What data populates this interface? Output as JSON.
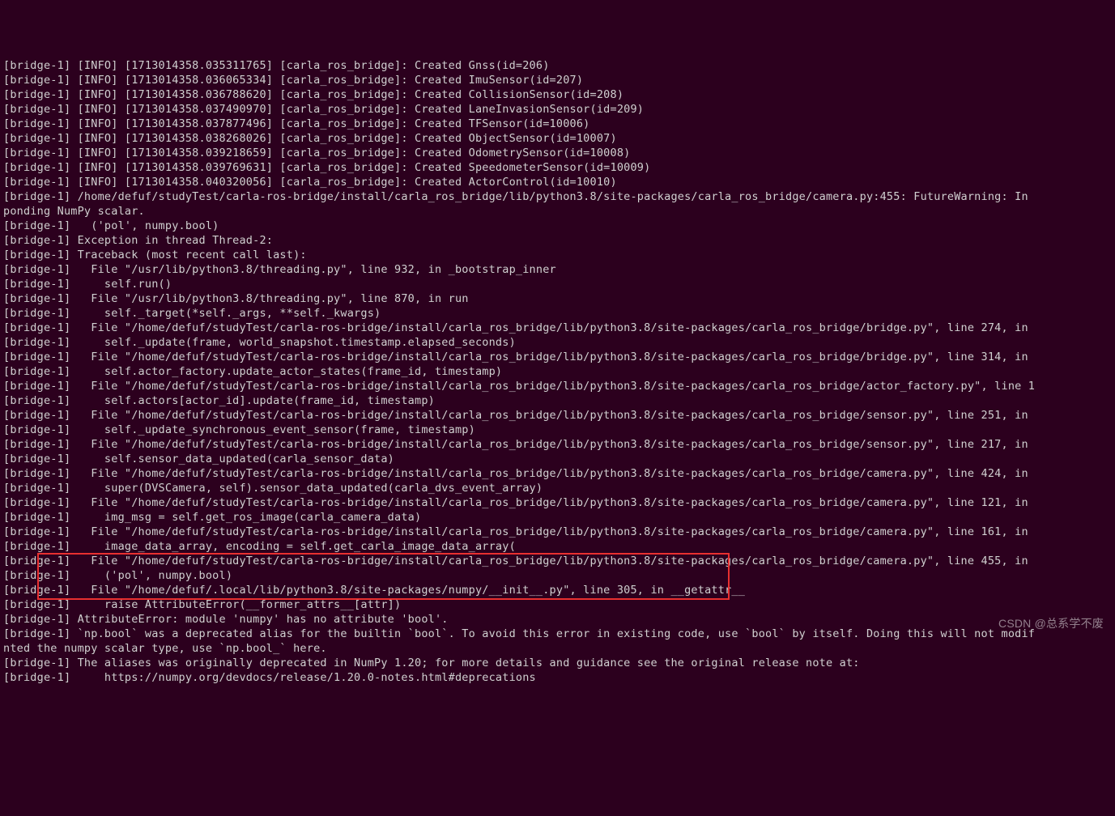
{
  "watermark": "CSDN @总系学不废",
  "lines": [
    "[bridge-1] [INFO] [1713014358.035311765] [carla_ros_bridge]: Created Gnss(id=206)",
    "[bridge-1] [INFO] [1713014358.036065334] [carla_ros_bridge]: Created ImuSensor(id=207)",
    "[bridge-1] [INFO] [1713014358.036788620] [carla_ros_bridge]: Created CollisionSensor(id=208)",
    "[bridge-1] [INFO] [1713014358.037490970] [carla_ros_bridge]: Created LaneInvasionSensor(id=209)",
    "[bridge-1] [INFO] [1713014358.037877496] [carla_ros_bridge]: Created TFSensor(id=10006)",
    "[bridge-1] [INFO] [1713014358.038268026] [carla_ros_bridge]: Created ObjectSensor(id=10007)",
    "[bridge-1] [INFO] [1713014358.039218659] [carla_ros_bridge]: Created OdometrySensor(id=10008)",
    "[bridge-1] [INFO] [1713014358.039769631] [carla_ros_bridge]: Created SpeedometerSensor(id=10009)",
    "[bridge-1] [INFO] [1713014358.040320056] [carla_ros_bridge]: Created ActorControl(id=10010)",
    "[bridge-1] /home/defuf/studyTest/carla-ros-bridge/install/carla_ros_bridge/lib/python3.8/site-packages/carla_ros_bridge/camera.py:455: FutureWarning: In ",
    "ponding NumPy scalar.",
    "[bridge-1]   ('pol', numpy.bool)",
    "[bridge-1] Exception in thread Thread-2:",
    "[bridge-1] Traceback (most recent call last):",
    "[bridge-1]   File \"/usr/lib/python3.8/threading.py\", line 932, in _bootstrap_inner",
    "[bridge-1]     self.run()",
    "[bridge-1]   File \"/usr/lib/python3.8/threading.py\", line 870, in run",
    "[bridge-1]     self._target(*self._args, **self._kwargs)",
    "[bridge-1]   File \"/home/defuf/studyTest/carla-ros-bridge/install/carla_ros_bridge/lib/python3.8/site-packages/carla_ros_bridge/bridge.py\", line 274, in ",
    "[bridge-1]     self._update(frame, world_snapshot.timestamp.elapsed_seconds)",
    "[bridge-1]   File \"/home/defuf/studyTest/carla-ros-bridge/install/carla_ros_bridge/lib/python3.8/site-packages/carla_ros_bridge/bridge.py\", line 314, in ",
    "[bridge-1]     self.actor_factory.update_actor_states(frame_id, timestamp)",
    "[bridge-1]   File \"/home/defuf/studyTest/carla-ros-bridge/install/carla_ros_bridge/lib/python3.8/site-packages/carla_ros_bridge/actor_factory.py\", line 1",
    "[bridge-1]     self.actors[actor_id].update(frame_id, timestamp)",
    "[bridge-1]   File \"/home/defuf/studyTest/carla-ros-bridge/install/carla_ros_bridge/lib/python3.8/site-packages/carla_ros_bridge/sensor.py\", line 251, in ",
    "[bridge-1]     self._update_synchronous_event_sensor(frame, timestamp)",
    "[bridge-1]   File \"/home/defuf/studyTest/carla-ros-bridge/install/carla_ros_bridge/lib/python3.8/site-packages/carla_ros_bridge/sensor.py\", line 217, in ",
    "[bridge-1]     self.sensor_data_updated(carla_sensor_data)",
    "[bridge-1]   File \"/home/defuf/studyTest/carla-ros-bridge/install/carla_ros_bridge/lib/python3.8/site-packages/carla_ros_bridge/camera.py\", line 424, in ",
    "[bridge-1]     super(DVSCamera, self).sensor_data_updated(carla_dvs_event_array)",
    "[bridge-1]   File \"/home/defuf/studyTest/carla-ros-bridge/install/carla_ros_bridge/lib/python3.8/site-packages/carla_ros_bridge/camera.py\", line 121, in ",
    "[bridge-1]     img_msg = self.get_ros_image(carla_camera_data)",
    "[bridge-1]   File \"/home/defuf/studyTest/carla-ros-bridge/install/carla_ros_bridge/lib/python3.8/site-packages/carla_ros_bridge/camera.py\", line 161, in ",
    "[bridge-1]     image_data_array, encoding = self.get_carla_image_data_array(",
    "[bridge-1]   File \"/home/defuf/studyTest/carla-ros-bridge/install/carla_ros_bridge/lib/python3.8/site-packages/carla_ros_bridge/camera.py\", line 455, in ",
    "[bridge-1]     ('pol', numpy.bool)",
    "[bridge-1]   File \"/home/defuf/.local/lib/python3.8/site-packages/numpy/__init__.py\", line 305, in __getattr__",
    "[bridge-1]     raise AttributeError(__former_attrs__[attr])",
    "[bridge-1] AttributeError: module 'numpy' has no attribute 'bool'.",
    "[bridge-1] `np.bool` was a deprecated alias for the builtin `bool`. To avoid this error in existing code, use `bool` by itself. Doing this will not modif",
    "nted the numpy scalar type, use `np.bool_` here.",
    "[bridge-1] The aliases was originally deprecated in NumPy 1.20; for more details and guidance see the original release note at:",
    "[bridge-1]     https://numpy.org/devdocs/release/1.20.0-notes.html#deprecations"
  ]
}
